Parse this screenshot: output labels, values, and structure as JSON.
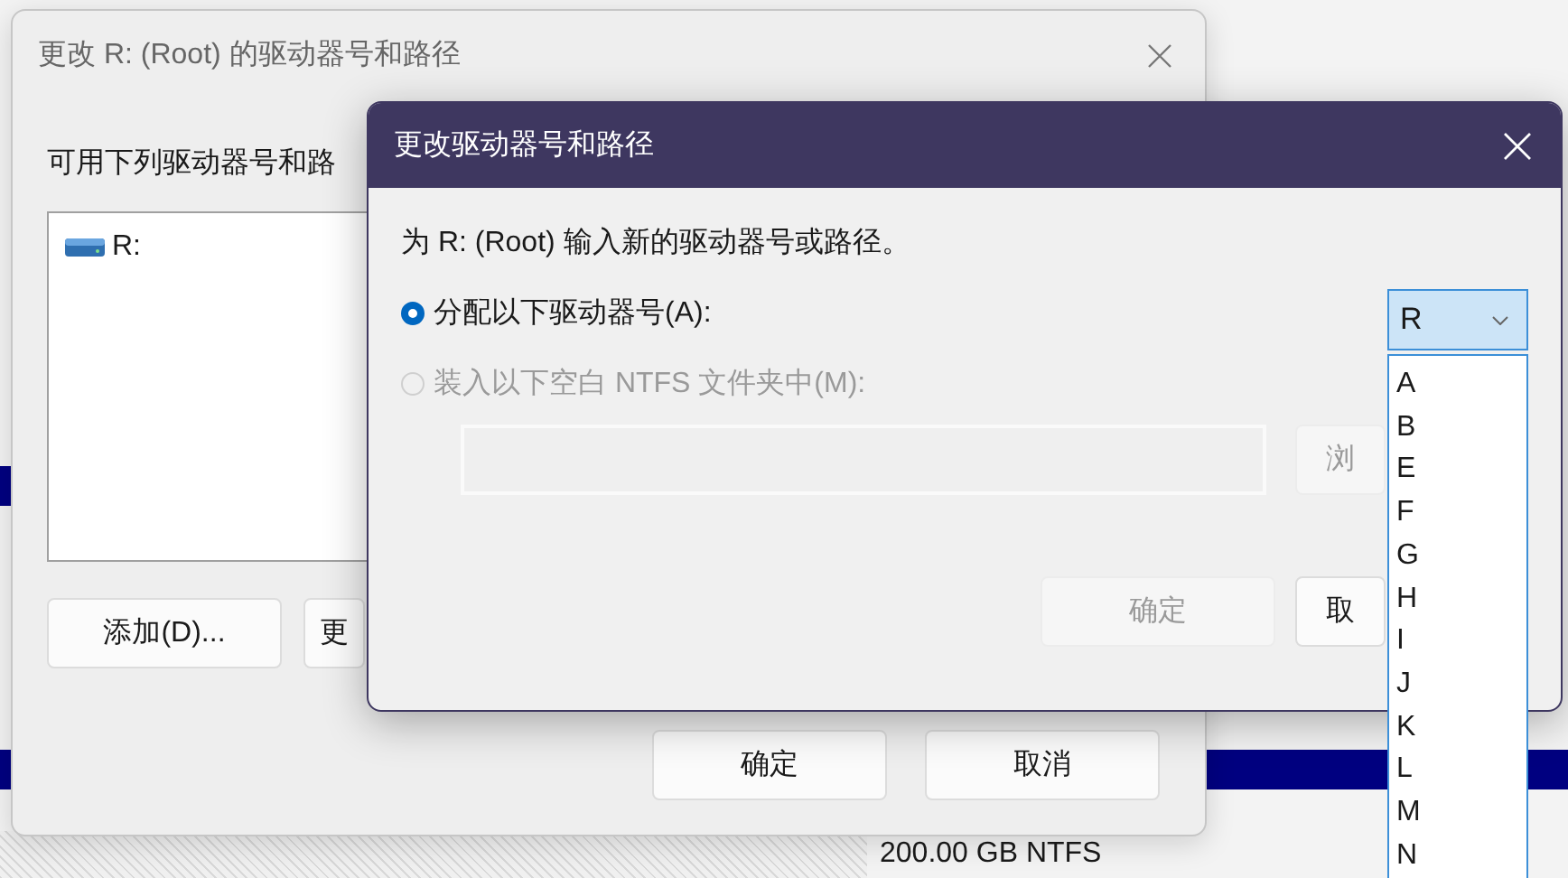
{
  "disk_management": {
    "volume_info": "200.00 GB NTFS"
  },
  "back_window": {
    "title": "更改 R: (Root) 的驱动器号和路径",
    "label": "可用下列驱动器号和路",
    "items": [
      "R:"
    ],
    "buttons": [
      "添加(D)...",
      "更"
    ],
    "footer_buttons": [
      "确定",
      "取消"
    ]
  },
  "dialog": {
    "title": "更改驱动器号和路径",
    "prompt": "为 R: (Root) 输入新的驱动器号或路径。",
    "options": [
      {
        "label": "分配以下驱动器号(A):",
        "selected": true,
        "disabled": false
      },
      {
        "label": "装入以下空白 NTFS 文件夹中(M):",
        "selected": false,
        "disabled": true
      }
    ],
    "path_field": {
      "disabled": true
    },
    "browse_button": {
      "label": "浏",
      "disabled": true
    },
    "buttons": [
      {
        "label": "确定",
        "disabled": true
      },
      {
        "label": "取",
        "disabled": false
      }
    ],
    "drive_letter": {
      "value": "R",
      "options": [
        "A",
        "B",
        "E",
        "F",
        "G",
        "H",
        "I",
        "J",
        "K",
        "L",
        "M",
        "N"
      ]
    }
  }
}
